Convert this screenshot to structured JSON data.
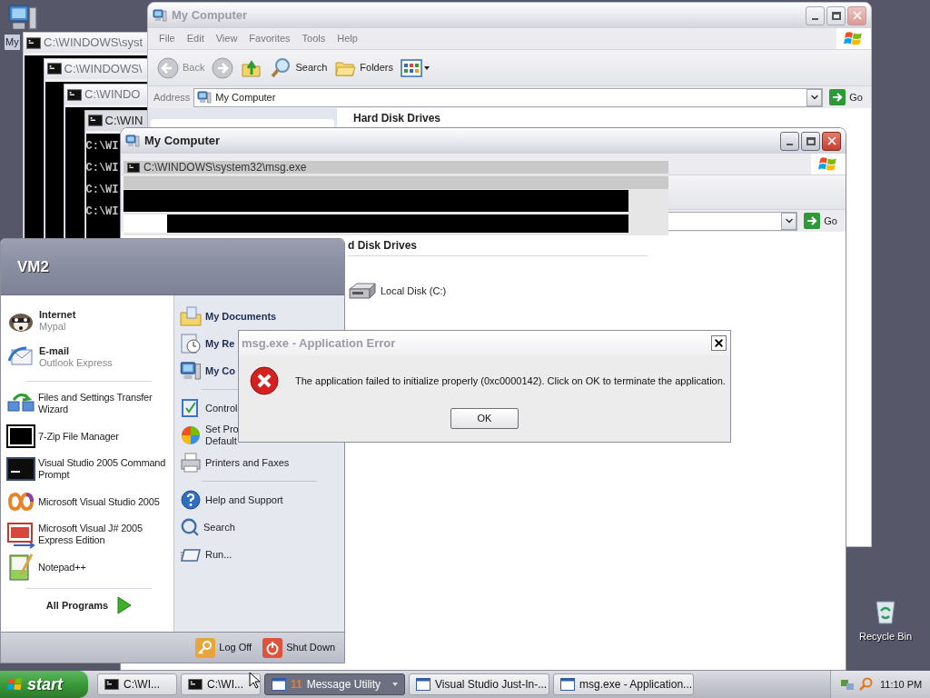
{
  "desktop_icons": [
    {
      "kind": "computer",
      "label": "My"
    },
    {
      "kind": "recycle_bin",
      "label": "Recycle Bin"
    }
  ],
  "console_windows": [
    {
      "title": "C:\\WINDOWS\\syst"
    },
    {
      "title": "C:\\WINDOWS\\"
    },
    {
      "title": "C:\\WINDO"
    },
    {
      "title": "C:\\WIN",
      "lines": [
        "C:\\WI",
        "C:\\WI",
        "C:\\WI",
        "C:\\WI"
      ]
    }
  ],
  "explorer_back": {
    "title": "My Computer",
    "active": false,
    "menu": [
      "File",
      "Edit",
      "View",
      "Favorites",
      "Tools",
      "Help"
    ],
    "toolbar": [
      {
        "kind": "back",
        "label": "Back"
      },
      {
        "kind": "forward"
      },
      {
        "kind": "up"
      },
      {
        "kind": "search",
        "label": "Search"
      },
      {
        "kind": "folders",
        "label": "Folders"
      },
      {
        "kind": "views"
      }
    ],
    "address_label": "Address",
    "address": "My Computer",
    "go": "Go",
    "section": "Hard Disk Drives"
  },
  "explorer_front": {
    "title": "My Computer",
    "active": true,
    "ghost_title": "C:\\WINDOWS\\system32\\msg.exe",
    "go": "Go",
    "section": "d Disk Drives",
    "drives": [
      {
        "label": "Local Disk (C:)"
      }
    ]
  },
  "start_menu": {
    "user": "VM2",
    "pinned": [
      {
        "kind": "internet",
        "title": "Internet",
        "subtitle": "Mypal"
      },
      {
        "kind": "email",
        "title": "E-mail",
        "subtitle": "Outlook Express"
      }
    ],
    "recent": [
      {
        "kind": "transfer",
        "label": "Files and Settings Transfer Wizard"
      },
      {
        "kind": "zip",
        "label": "7-Zip File Manager"
      },
      {
        "kind": "console",
        "label": "Visual Studio 2005 Command Prompt"
      },
      {
        "kind": "studio",
        "label": "Microsoft Visual Studio 2005"
      },
      {
        "kind": "jsharp",
        "label": "Microsoft Visual J# 2005 Express Edition"
      },
      {
        "kind": "notepad",
        "label": "Notepad++"
      }
    ],
    "all_programs": "All Programs",
    "places": [
      {
        "bold": true,
        "items": [
          {
            "kind": "documents",
            "label": "My Documents"
          },
          {
            "kind": "recent",
            "label": "My Re"
          },
          {
            "kind": "computer",
            "label": "My Co"
          }
        ]
      },
      {
        "bold": false,
        "items": [
          {
            "kind": "control",
            "label": "Control"
          },
          {
            "kind": "defaults",
            "label": "Set Pro\nDefault"
          },
          {
            "kind": "printer",
            "label": "Printers and Faxes"
          }
        ]
      },
      {
        "bold": false,
        "items": [
          {
            "kind": "help",
            "label": "Help and Support"
          },
          {
            "kind": "search",
            "label": "Search"
          },
          {
            "kind": "run",
            "label": "Run..."
          }
        ]
      }
    ],
    "log_off": "Log Off",
    "shut_down": "Shut Down"
  },
  "dialog": {
    "title": "msg.exe - Application Error",
    "message": "The application failed to initialize properly (0xc0000142). Click on OK to terminate the application.",
    "button": "OK"
  },
  "taskbar": {
    "start": "start",
    "tasks": [
      {
        "kind": "console",
        "label": "C:\\WI...",
        "selected": false
      },
      {
        "kind": "console",
        "label": "C:\\WI...",
        "selected": false
      },
      {
        "kind": "group",
        "count": "11",
        "label": "Message Utility",
        "selected": true
      },
      {
        "kind": "window",
        "label": "Visual Studio Just-In-...",
        "selected": false
      },
      {
        "kind": "window",
        "label": "msg.exe - Application...",
        "selected": false
      }
    ],
    "clock": "11:10 PM"
  }
}
